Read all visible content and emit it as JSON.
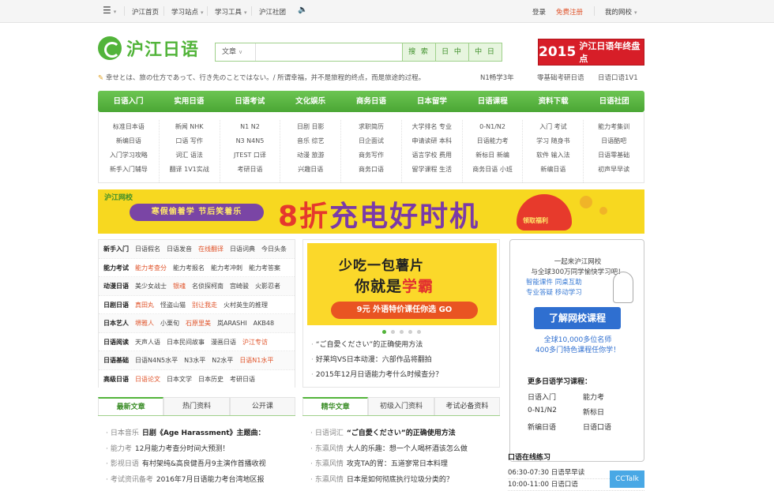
{
  "topbar": {
    "left": [
      "沪江首页",
      "学习站点",
      "学习工具",
      "沪江社团"
    ],
    "login": "登录",
    "register": "免费注册",
    "my_school": "我的网校"
  },
  "header": {
    "logo_text": "沪江日语",
    "search_category": "文章",
    "search_placeholder": "",
    "buttons": [
      "搜 索",
      "日 中",
      "中 日"
    ],
    "ad_year": "2015",
    "ad_text": "沪江日语年终盘点"
  },
  "motto": {
    "text": "幸せとは、旅の仕方であって、行き先のことではない。/ 所谓幸福，并不是旅程的终点，而是旅途的过程。",
    "links": [
      "N1畅学3年",
      "零基础考研日语",
      "日语口语1V1"
    ]
  },
  "nav": {
    "items": [
      "日语入门",
      "实用日语",
      "日语考试",
      "文化娱乐",
      "商务日语",
      "日本留学",
      "日语课程",
      "资料下载",
      "日语社团"
    ],
    "columns": [
      [
        "标准日本语",
        "新编日语",
        "入门学习攻略",
        "新手入门辅导"
      ],
      [
        "新闻 NHK",
        "口语 写作",
        "词汇 语法",
        "翻译 1V1实战"
      ],
      [
        "N1 N2",
        "N3 N4N5",
        "JTEST 口译",
        "考研日语"
      ],
      [
        "日剧 日影",
        "音乐 综艺",
        "动漫 旅游",
        "兴趣日语"
      ],
      [
        "求职简历",
        "日企面试",
        "商务写作",
        "商务口语"
      ],
      [
        "大学排名 专业",
        "申请读研 本科",
        "语言学校 费用",
        "留学课程 生活"
      ],
      [
        "0-N1/N2",
        "日语能力考",
        "新标日 新编",
        "商务日语 小班"
      ],
      [
        "入门 考试",
        "学习 随身书",
        "软件 输入法",
        "新编日语"
      ],
      [
        "能力考集训",
        "日语酷吧",
        "日语零基础",
        "初声早早读"
      ]
    ]
  },
  "banner": {
    "logo": "沪江网校",
    "pill": "寒假偷着学 节后笑着乐",
    "big_left": "8折",
    "big_right": "充电好时机",
    "bag": "领取福利"
  },
  "categories": [
    {
      "head": "新手入门",
      "links": [
        "日语假名",
        "日语发音",
        "在线翻译",
        "日语词典",
        "今日头条"
      ],
      "hot": [
        2
      ]
    },
    {
      "head": "能力考试",
      "links": [
        "能力考查分",
        "能力考报名",
        "能力考冲刺",
        "能力考答案"
      ],
      "hot": [
        0
      ]
    },
    {
      "head": "动漫日语",
      "links": [
        "美少女战士",
        "银魂",
        "名侦探柯南",
        "宫崎骏",
        "火影忍者"
      ],
      "hot": [
        1
      ]
    },
    {
      "head": "日剧日语",
      "links": [
        "真田丸",
        "怪盗山猫",
        "别让我走",
        "火村英生的推理"
      ],
      "hot": [
        0,
        2
      ]
    },
    {
      "head": "日本艺人",
      "links": [
        "堺雅人",
        "小栗旬",
        "石原里美",
        "岚ARASHI",
        "AKB48"
      ],
      "hot": [
        0,
        2
      ]
    },
    {
      "head": "日语阅读",
      "links": [
        "天声人语",
        "日本民间故事",
        "漫画日语",
        "沪江专访"
      ],
      "hot": [
        3
      ]
    },
    {
      "head": "日语基础",
      "links": [
        "日语N4N5水平",
        "N3水平",
        "N2水平",
        "日语N1水平"
      ],
      "hot": [
        3
      ]
    },
    {
      "head": "高级日语",
      "links": [
        "日语论文",
        "日本文学",
        "日本历史",
        "考研日语"
      ],
      "hot": [
        0
      ]
    }
  ],
  "mid_ad": {
    "line1": "少吃一包薯片",
    "line2a": "你就是",
    "line2b": "学霸",
    "line3": "9元 外语特价课任你选 GO"
  },
  "mid_list": [
    "“ご自愛ください”的正确使用方法",
    "好莱坞VS日本动漫：六部作品将翻拍",
    "2015年12月日语能力考什么时候查分？"
  ],
  "left_tabs": {
    "tabs": [
      "最新文章",
      "热门资料",
      "公开课"
    ],
    "items": [
      {
        "cat": "日本音乐",
        "title": "日剧《Age Harassment》主题曲："
      },
      {
        "cat": "能力考",
        "title": "12月能力考查分时间大预测！"
      },
      {
        "cat": "影视日语",
        "title": "有村架纯&高良健吾月9主演作首播收视"
      },
      {
        "cat": "考试资讯备考",
        "title": "2016年7月日语能力考台湾地区报"
      }
    ]
  },
  "mid_tabs": {
    "tabs": [
      "精华文章",
      "初级入门资料",
      "考试必备资料"
    ],
    "items": [
      {
        "cat": "日语词汇",
        "title": "“ご自愛ください”的正确使用方法"
      },
      {
        "cat": "东瀛风情",
        "title": "大人的乐趣：想一个人喝杯酒该怎么做"
      },
      {
        "cat": "东瀛风情",
        "title": "攻克TA的胃：五道寥常日本料理"
      },
      {
        "cat": "东瀛风情",
        "title": "日本是如何彻底执行垃圾分类的？"
      }
    ]
  },
  "right_panel": {
    "intro1": "一起来沪江网校",
    "intro2": "与全球300万同学愉快学习吧！",
    "feat1": "智能课件 同桌互助",
    "feat2": "专业答疑 移动学习",
    "button": "了解网校课程",
    "teachers": "全球10,000多位名师",
    "courses": "400多门特色课程任你学！",
    "more_title": "更多日语学习课程：",
    "course_links": [
      "日语入门",
      "能力考",
      "0-N1/N2",
      "新标日",
      "新编日语",
      "日语口语"
    ]
  },
  "practice": {
    "title": "口语在线练习",
    "rows": [
      "06:30-07:30 日语早早读",
      "10:00-11:00 日语口语"
    ],
    "badge": "CCTalk"
  }
}
